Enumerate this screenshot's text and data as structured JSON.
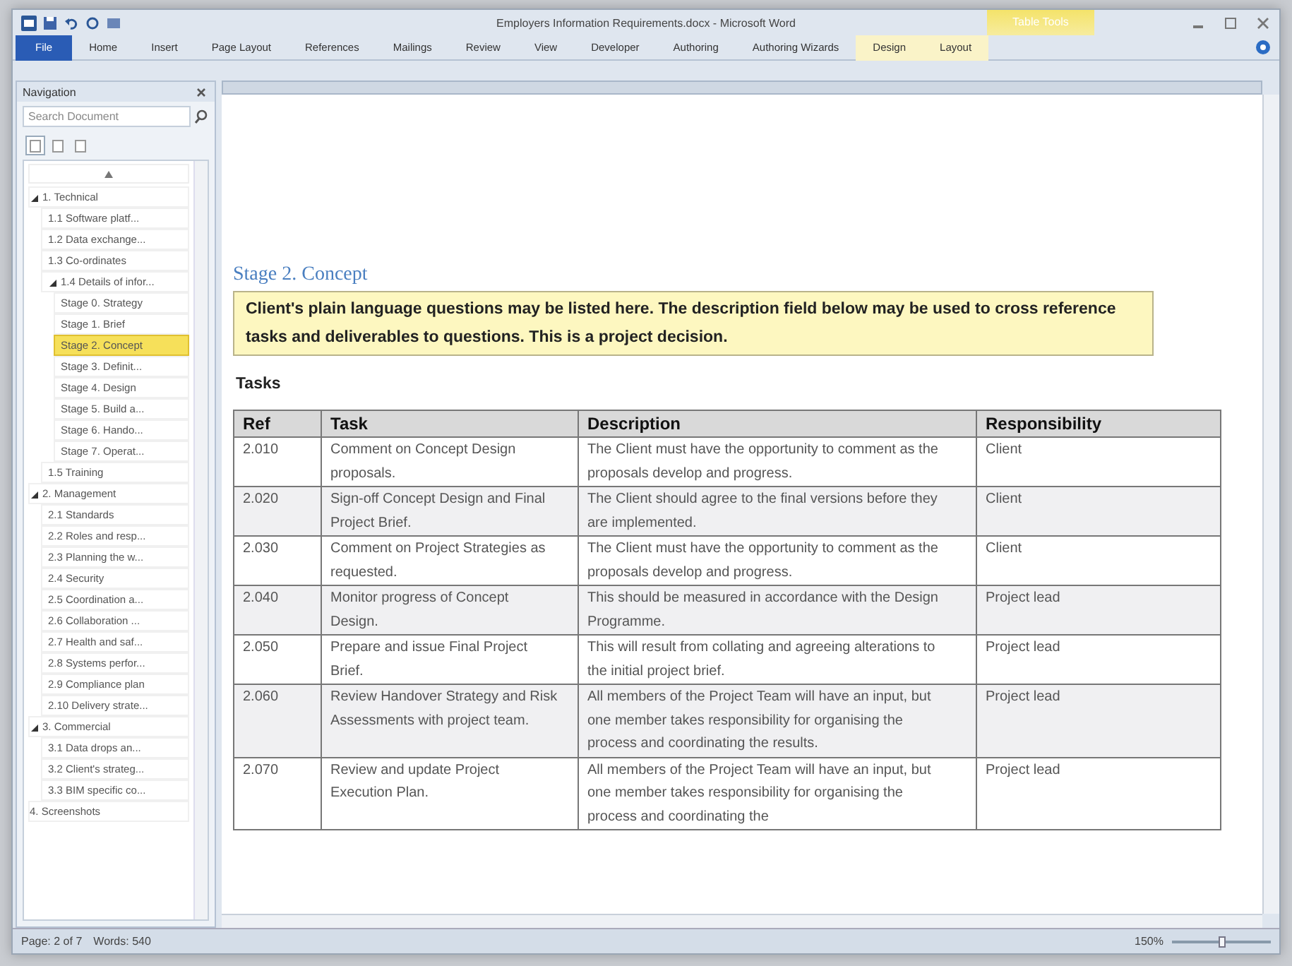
{
  "window": {
    "title": "Employers Information Requirements.docx - Microsoft Word"
  },
  "ribbon": {
    "context_label": "Table Tools",
    "tabs": [
      {
        "label": "File",
        "kind": "file"
      },
      {
        "label": "Home",
        "kind": "normal"
      },
      {
        "label": "Insert",
        "kind": "normal"
      },
      {
        "label": "Page Layout",
        "kind": "normal"
      },
      {
        "label": "References",
        "kind": "normal"
      },
      {
        "label": "Mailings",
        "kind": "normal"
      },
      {
        "label": "Review",
        "kind": "normal"
      },
      {
        "label": "View",
        "kind": "normal"
      },
      {
        "label": "Developer",
        "kind": "normal"
      },
      {
        "label": "Authoring",
        "kind": "normal"
      },
      {
        "label": "Authoring Wizards",
        "kind": "normal"
      },
      {
        "label": "Design",
        "kind": "context"
      },
      {
        "label": "Layout",
        "kind": "context"
      }
    ]
  },
  "navigation": {
    "title": "Navigation",
    "search": {
      "placeholder": "Search Document"
    },
    "views": [
      {
        "selected": true
      },
      {
        "selected": false
      },
      {
        "selected": false
      }
    ],
    "tree": [
      {
        "label": "1. Technical",
        "expanded": true,
        "selected": false,
        "children": [
          {
            "label": "1.1 Software platf...",
            "selected": false
          },
          {
            "label": "1.2 Data exchange...",
            "selected": false
          },
          {
            "label": "1.3 Co-ordinates",
            "selected": false
          },
          {
            "label": "1.4 Details of infor...",
            "expanded": true,
            "selected": false,
            "children": [
              {
                "label": "Stage 0. Strategy",
                "selected": false
              },
              {
                "label": "Stage 1. Brief",
                "selected": false
              },
              {
                "label": "Stage 2. Concept",
                "selected": true
              },
              {
                "label": "Stage 3. Definit...",
                "selected": false
              },
              {
                "label": "Stage 4. Design",
                "selected": false
              },
              {
                "label": "Stage 5. Build a...",
                "selected": false
              },
              {
                "label": "Stage 6. Hando...",
                "selected": false
              },
              {
                "label": "Stage 7. Operat...",
                "selected": false
              }
            ]
          },
          {
            "label": "1.5 Training",
            "selected": false
          }
        ]
      },
      {
        "label": "2. Management",
        "expanded": true,
        "selected": false,
        "children": [
          {
            "label": "2.1 Standards",
            "selected": false
          },
          {
            "label": "2.2 Roles and resp...",
            "selected": false
          },
          {
            "label": "2.3 Planning the w...",
            "selected": false
          },
          {
            "label": "2.4 Security",
            "selected": false
          },
          {
            "label": "2.5 Coordination a...",
            "selected": false
          },
          {
            "label": "2.6 Collaboration ...",
            "selected": false
          },
          {
            "label": "2.7 Health and saf...",
            "selected": false
          },
          {
            "label": "2.8 Systems perfor...",
            "selected": false
          },
          {
            "label": "2.9 Compliance plan",
            "selected": false
          },
          {
            "label": "2.10 Delivery strate...",
            "selected": false
          }
        ]
      },
      {
        "label": "3. Commercial",
        "expanded": true,
        "selected": false,
        "children": [
          {
            "label": "3.1 Data drops an...",
            "selected": false
          },
          {
            "label": "3.2 Client's strateg...",
            "selected": false
          },
          {
            "label": "3.3 BIM specific co...",
            "selected": false
          }
        ]
      },
      {
        "label": "4. Screenshots",
        "selected": false
      }
    ]
  },
  "document": {
    "heading": "Stage 2. Concept",
    "note": "Client's plain language questions may be listed here. The description field below may be used to cross reference tasks and deliverables to questions. This is a project decision.",
    "subheading": "Tasks",
    "table": {
      "columns": [
        "Ref",
        "Task",
        "Description",
        "Responsibility"
      ],
      "rows": [
        [
          "2.010",
          "Comment on Concept Design proposals.",
          "The Client must have the opportunity to comment as the proposals develop and progress.",
          "Client"
        ],
        [
          "2.020",
          "Sign-off Concept Design and Final Project Brief.",
          "The Client should agree to the final versions before they are implemented.",
          "Client"
        ],
        [
          "2.030",
          "Comment on Project Strategies as requested.",
          "The Client must have the opportunity to comment as the proposals develop and progress.",
          "Client"
        ],
        [
          "2.040",
          "Monitor progress of Concept Design.",
          "This should be measured in accordance with the Design Programme.",
          "Project lead"
        ],
        [
          "2.050",
          "Prepare and issue Final Project Brief.",
          "This will result from collating and agreeing alterations to the initial project brief.",
          "Project lead"
        ],
        [
          "2.060",
          "Review Handover Strategy and Risk Assessments with project team.",
          "All members of the Project Team will have an input, but one member takes responsibility for organising the process and coordinating the results.",
          "Project lead"
        ],
        [
          "2.070",
          "Review and update Project Execution Plan.",
          "All members of the Project Team will have an input, but one member takes responsibility for organising the process and coordinating the",
          "Project lead"
        ]
      ]
    }
  },
  "status_bar": {
    "page": "Page: 2 of 7",
    "words": "Words: 540",
    "zoom": "150%",
    "zoom_slider": {
      "level": 0.5
    }
  }
}
